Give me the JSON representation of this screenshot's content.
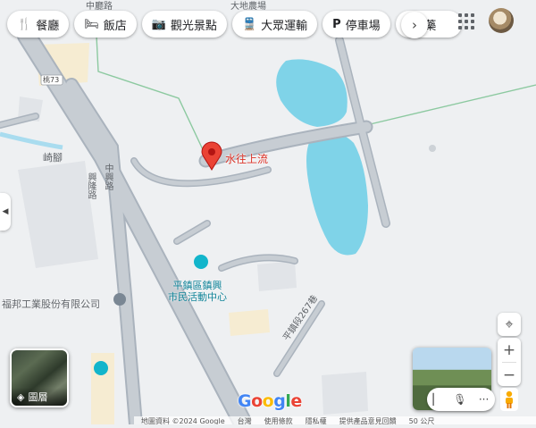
{
  "filters": [
    {
      "icon": "🍴",
      "icon_name": "fork-knife-icon",
      "label": "餐廳"
    },
    {
      "icon": "🛏",
      "icon_name": "bed-icon",
      "label": "飯店"
    },
    {
      "icon": "📷",
      "icon_name": "camera-icon",
      "label": "觀光景點"
    },
    {
      "icon": "🚆",
      "icon_name": "train-icon",
      "label": "大眾運輸"
    },
    {
      "icon": "P",
      "icon_name": "parking-icon",
      "label": "停車場"
    },
    {
      "icon": "⛩",
      "icon_name": "pharmacy-icon",
      "label": "藥"
    }
  ],
  "more_filters_icon": "›",
  "map_labels": {
    "place_marker": "水往上流",
    "community_center_line1": "平鎮區鎮興",
    "community_center_line2": "市民活動中心",
    "company": "福邦工業股份有限公司",
    "road_zhongxing": "中興路",
    "road_xinglong": "興隆路",
    "road_qi": "崎腳",
    "lane_267": "平鎮段267巷",
    "route_badge": "桃73",
    "farm_fragment": "大地農場",
    "top_fragment": "中廳路"
  },
  "layers_label": "圖層",
  "zoom": {
    "in": "+",
    "out": "−"
  },
  "footer": [
    "地圖資料 ©2024 Google",
    "台灣",
    "使用條款",
    "隱私權",
    "提供產品意見回饋",
    "50 公尺"
  ],
  "google_logo": [
    "G",
    "o",
    "o",
    "g",
    "l",
    "e"
  ],
  "colors": {
    "water": "#7fd3e8",
    "road": "#aab3bd",
    "marker": "#ea4335",
    "poi": "#12b5cb"
  }
}
